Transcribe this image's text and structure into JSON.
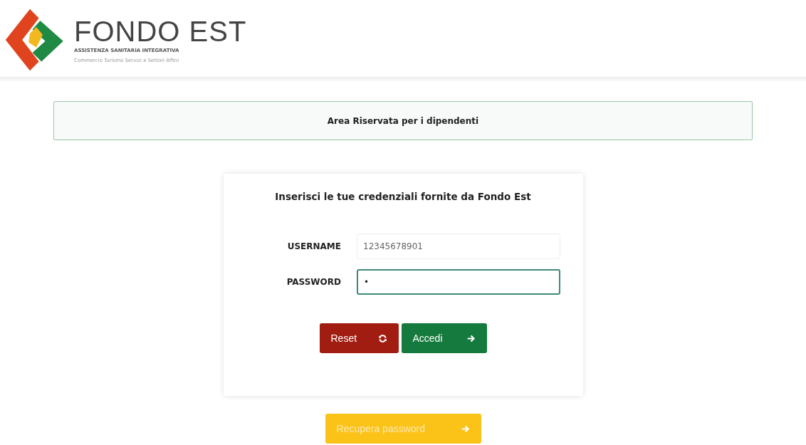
{
  "logo": {
    "name": "FONDO EST",
    "tagline": "ASSISTENZA SANITARIA INTEGRATIVA",
    "subtitle": "Commercio Turismo Servizi e Settori Affini"
  },
  "banner": {
    "title": "Area Riservata per i dipendenti"
  },
  "login": {
    "heading": "Inserisci le tue credenziali fornite da Fondo Est",
    "fields": [
      {
        "label": "USERNAME",
        "value": "12345678901",
        "focused": false
      },
      {
        "label": "PASSWORD",
        "value": "•",
        "focused": true
      }
    ],
    "buttons": [
      {
        "label": "Reset",
        "kind": "reset"
      },
      {
        "label": "Accedi",
        "kind": "submit"
      }
    ]
  },
  "recover": {
    "label": "Recupera password"
  }
}
